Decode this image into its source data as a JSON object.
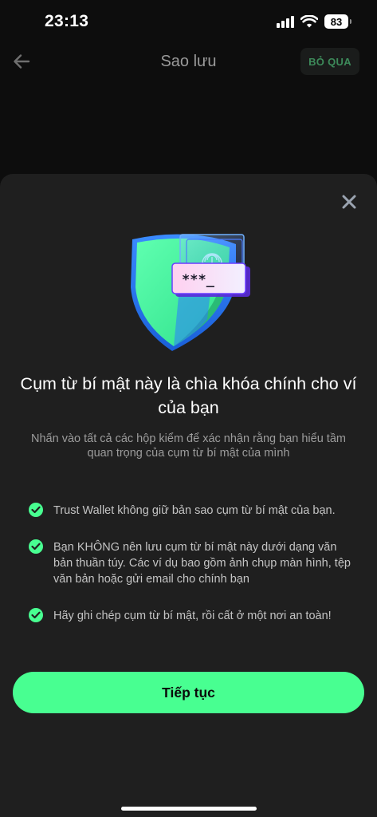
{
  "status_bar": {
    "time": "23:13",
    "battery": "83",
    "icons": [
      "signal-icon",
      "wifi-icon",
      "battery-icon"
    ]
  },
  "header": {
    "back_icon": "arrow-left-icon",
    "title": "Sao lưu",
    "skip_label": "BỎ QUA"
  },
  "sheet": {
    "close_icon": "close-icon",
    "illustration_icon": "shield-password-illustration",
    "password_mask": "***_",
    "title": "Cụm từ bí mật này là chìa khóa chính cho ví của bạn",
    "subtitle": "Nhấn vào tất cả các hộp kiểm để xác nhận rằng bạn hiểu tầm quan trọng của cụm từ bí mật của mình",
    "items": [
      {
        "label": "Trust Wallet không giữ bản sao cụm từ bí mật của bạn.",
        "checked": true
      },
      {
        "label": "Bạn KHÔNG nên lưu cụm từ bí mật này dưới dạng văn bản thuần túy. Các ví dụ bao gồm ảnh chụp màn hình, tệp văn bản hoặc gửi email cho chính bạn",
        "checked": true
      },
      {
        "label": "Hãy ghi chép cụm từ bí mật, rồi cất ở một nơi an toàn!",
        "checked": true
      }
    ],
    "continue_label": "Tiếp tục"
  },
  "colors": {
    "accent": "#48ff91",
    "sheet_background": "#1f1f1f",
    "page_background": "#0d0d0d"
  }
}
